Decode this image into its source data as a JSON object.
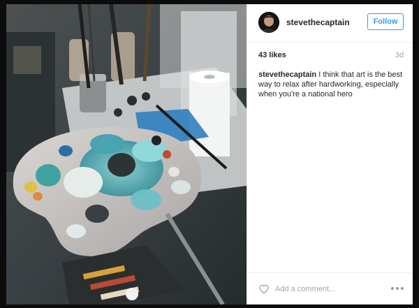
{
  "post": {
    "username": "stevethecaptain",
    "follow_label": "Follow",
    "likes": "43 likes",
    "timestamp": "3d",
    "caption_user": "stevethecaptain",
    "caption_text": " I think that art is the best way to relax after hardworking, especially when you're a national hero",
    "comment_placeholder": "Add a comment...",
    "photo_subject": "paint palette with oil paints, brushes and paper towel roll"
  },
  "icons": {
    "like": "heart-icon",
    "options": "more-options-icon"
  },
  "colors": {
    "accent": "#3897f0",
    "text": "#262626",
    "muted": "#a5a5a5",
    "border": "#efefef",
    "backdrop": "#0c0c0c"
  }
}
